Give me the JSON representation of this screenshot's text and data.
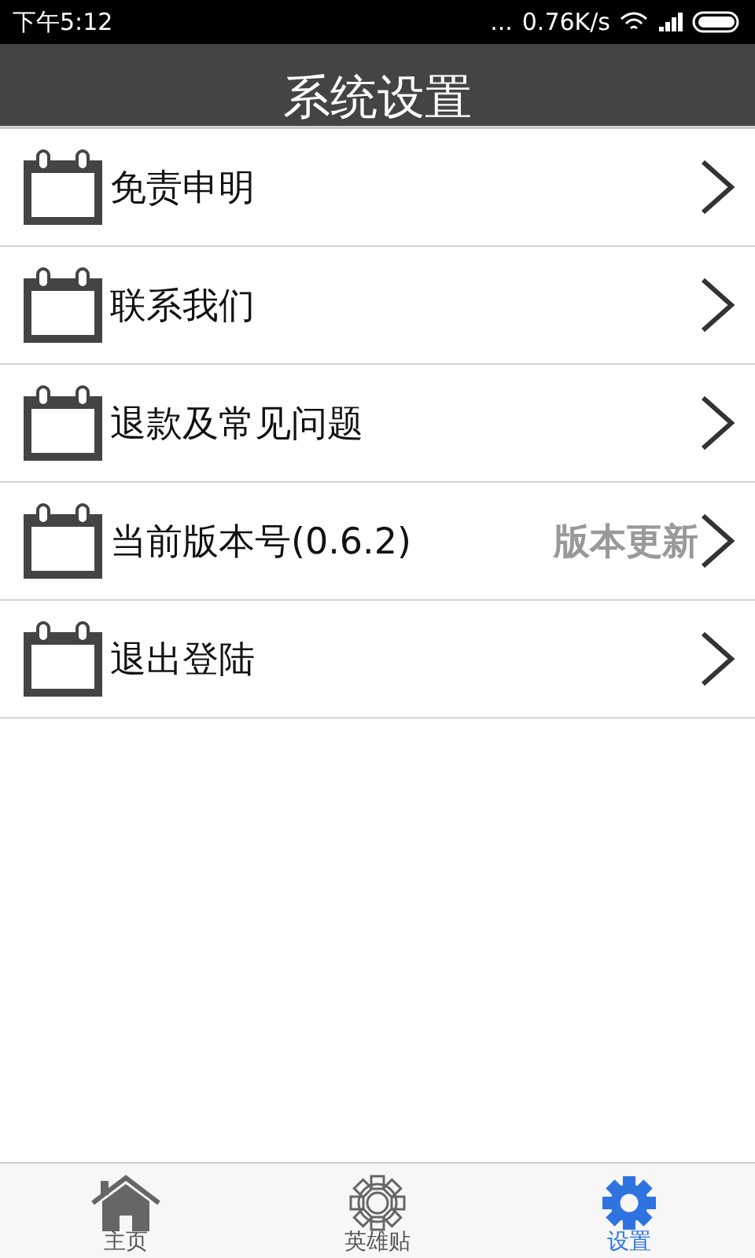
{
  "status_bar": {
    "time": "下午5:12",
    "dots": "...",
    "speed": "0.76K/s"
  },
  "header": {
    "title": "系统设置"
  },
  "items": [
    {
      "label": "免责申明"
    },
    {
      "label": "联系我们"
    },
    {
      "label": "退款及常见问题"
    },
    {
      "label": "当前版本号(0.6.2)",
      "note": "版本更新"
    },
    {
      "label": "退出登陆"
    }
  ],
  "tabs": [
    {
      "label": "主页",
      "kind": "home",
      "selected": false
    },
    {
      "label": "英雄贴",
      "kind": "gear",
      "selected": false
    },
    {
      "label": "设置",
      "kind": "gear",
      "selected": true
    }
  ]
}
